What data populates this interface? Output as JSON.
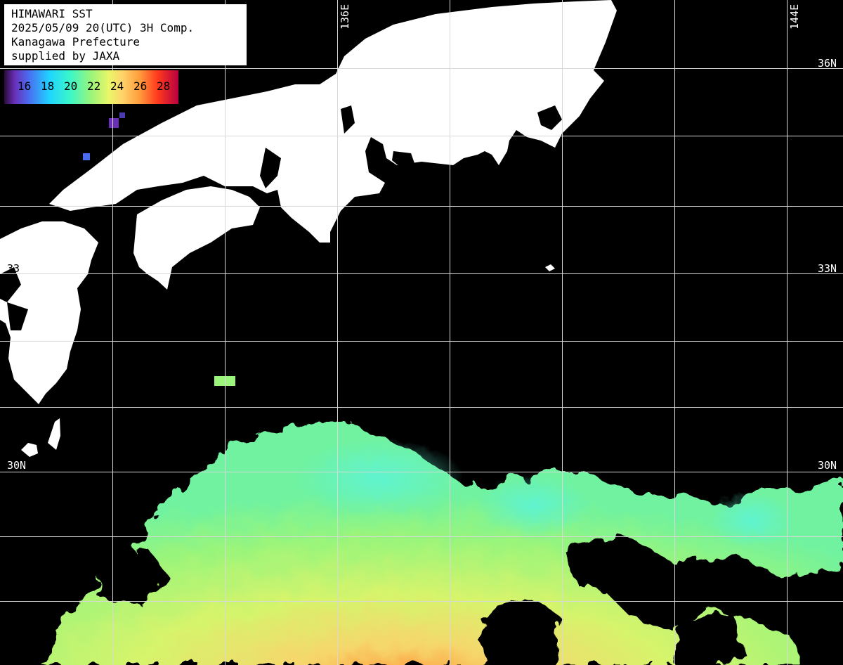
{
  "title": {
    "lines": [
      "HIMAWARI SST",
      "2025/05/09 20(UTC) 3H Comp.",
      "Kanagawa Prefecture",
      "supplied by JAXA"
    ]
  },
  "colorbar": {
    "ticks": [
      "16",
      "18",
      "20",
      "22",
      "24",
      "26",
      "28"
    ]
  },
  "grid_labels": {
    "lat": [
      "36N",
      "33",
      "33N",
      "30N",
      "30N"
    ],
    "lon": [
      "136E",
      "144E"
    ]
  },
  "colors": {
    "land": "#ffffff",
    "no_data": "#000000",
    "grid": "#ffffff",
    "sst_cool": "#3cf7c8",
    "sst_mid": "#9bf57a",
    "sst_warm": "#e9f768",
    "sst_hot": "#ff9a3a"
  }
}
